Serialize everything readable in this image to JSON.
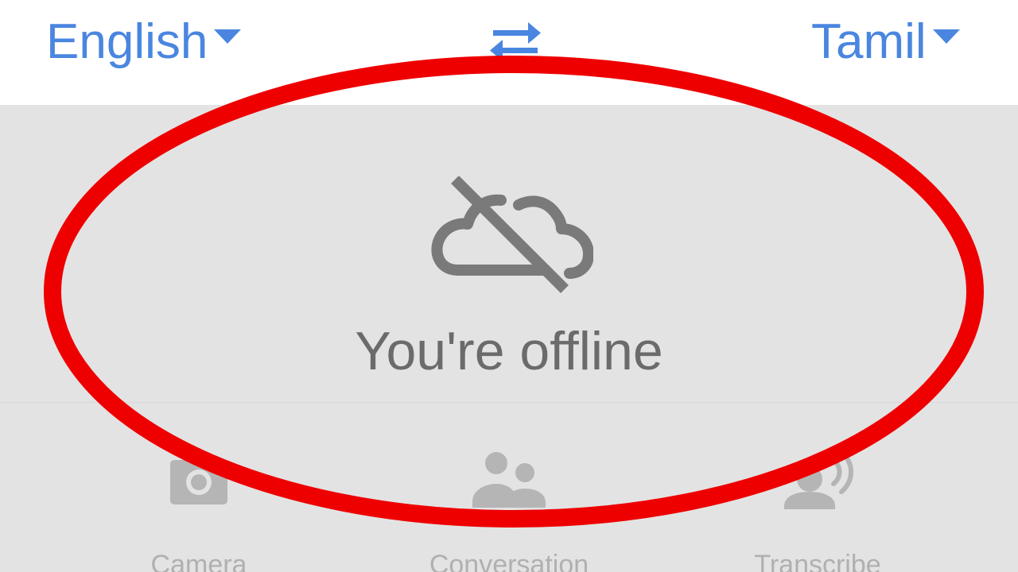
{
  "language_bar": {
    "source_language": "English",
    "target_language": "Tamil",
    "swap_icon": "swap-arrows-icon"
  },
  "offline_panel": {
    "icon": "cloud-off-icon",
    "message": "You're offline"
  },
  "tools": [
    {
      "label": "Camera",
      "icon": "camera-icon"
    },
    {
      "label": "Conversation",
      "icon": "people-icon"
    },
    {
      "label": "Transcribe",
      "icon": "transcribe-icon"
    }
  ],
  "colors": {
    "accent": "#4a86e0",
    "panel_background": "#e3e3e3",
    "offline_text": "#6b6b6b",
    "disabled_tool": "#b0b0b0",
    "annotation": "#ee0000"
  }
}
